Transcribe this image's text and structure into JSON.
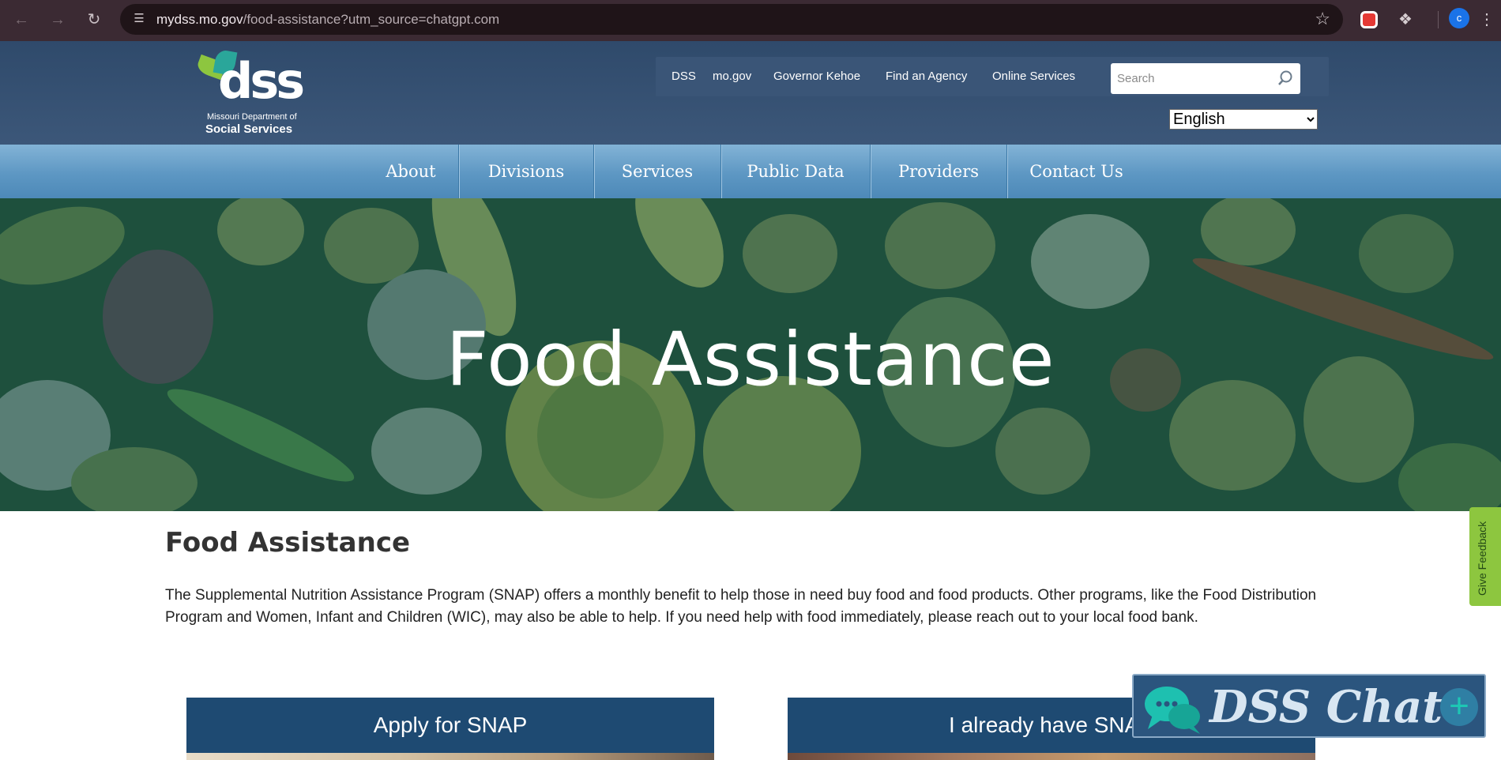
{
  "browser": {
    "url_host": "mydss.mo.gov",
    "url_path": "/food-assistance?utm_source=chatgpt.com",
    "profile_initial": "c",
    "icons": [
      "back-arrow-icon",
      "forward-arrow-icon",
      "reload-icon",
      "site-info-icon",
      "bookmark-star-icon",
      "extension-icon",
      "puzzle-icon",
      "kebab-menu-icon"
    ]
  },
  "header": {
    "logo": {
      "wordmark": "dss",
      "line1": "Missouri Department of",
      "line2": "Social Services"
    },
    "util_links": [
      "DSS",
      "mo.gov",
      "Governor Kehoe",
      "Find an Agency",
      "Online Services"
    ],
    "search_placeholder": "Search",
    "language": "English",
    "language_options": [
      "English"
    ]
  },
  "nav": {
    "items": [
      "About",
      "Divisions",
      "Services",
      "Public Data",
      "Providers",
      "Contact Us"
    ]
  },
  "hero": {
    "title": "Food Assistance"
  },
  "main": {
    "title": "Food Assistance",
    "intro": "The Supplemental Nutrition Assistance Program (SNAP) offers a monthly benefit to help those in need buy food and food products. Other programs, like the Food Distribution Program and Women, Infant and Children (WIC), may also be able to help. If you need help with food immediately, please reach out to your local food bank.",
    "cards": [
      {
        "title": "Apply for SNAP"
      },
      {
        "title": "I already have SNAP"
      }
    ]
  },
  "feedback": {
    "label": "Give Feedback",
    "color": "#8dc63f"
  },
  "chat": {
    "label": "DSS Chat",
    "plus": "+"
  },
  "colors": {
    "header_bg": "#34506f",
    "nav_bg": "#5d97c3",
    "card_header": "#1e4a72",
    "chat_bg": "#2b557e"
  }
}
